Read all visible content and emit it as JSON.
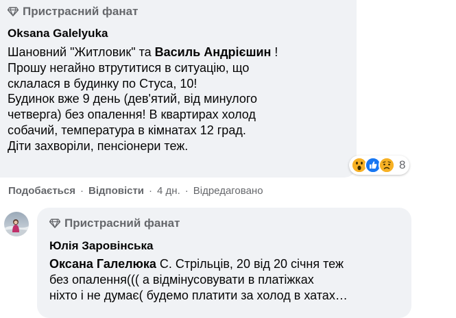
{
  "comment": {
    "badge": "Пристрасний фанат",
    "author": "Oksana Galelyuka",
    "lines": [
      {
        "before": "Шановний \"Житловик\" та ",
        "mention": "Василь Андрієшин",
        "after": " !"
      },
      {
        "text": "Прошу негайно втрутитися в ситуацію, що"
      },
      {
        "text": "склалася в будинку по Стуса, 10!"
      },
      {
        "text": "Будинок вже 9 день (дев'ятий, від минулого"
      },
      {
        "text": "четверга) без опалення! В квартирах холод"
      },
      {
        "text": "собачий, температура в кімнатах 12 град."
      },
      {
        "text": "Діти захворіли, пенсіонери теж."
      }
    ],
    "reactions": {
      "icons": [
        "wow-reaction-icon",
        "like-reaction-icon",
        "sad-reaction-icon"
      ],
      "count": "8"
    },
    "actions": {
      "like": "Подобається",
      "reply": "Відповісти",
      "time": "4 дн.",
      "edited": "Відредаговано",
      "separator": "·"
    }
  },
  "reply": {
    "badge": "Пристрасний фанат",
    "author": "Юлія Заровінська",
    "lines": [
      {
        "mention": "Оксана Галелюка",
        "after": " С. Стрільців, 20 від 20 січня теж"
      },
      {
        "text": "без опалення((( а відмінусовувати в платіжках"
      },
      {
        "text": "ніхто і не думає( будемо платити за холод в хатах…"
      }
    ]
  },
  "colors": {
    "bubble": "#f0f2f5",
    "secondary_text": "#65676b",
    "primary_text": "#050505",
    "like_blue": "#1877f2",
    "reaction_yellow": "#f7b125"
  }
}
